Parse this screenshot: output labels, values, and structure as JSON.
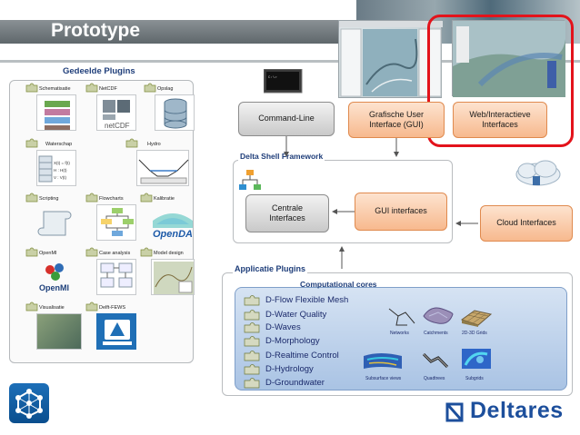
{
  "header": {
    "title": "Prototype"
  },
  "left_panel": {
    "title": "Gedeelde Plugins",
    "plugins": [
      {
        "label": "Schematisatie"
      },
      {
        "label": "NetCDF",
        "image_text": "netCDF"
      },
      {
        "label": "Opslag"
      },
      {
        "label": "Waterschap",
        "image_text": "X(t) = f(t)\nH : H(t)\nV : V(t)"
      },
      {
        "label": "Hydro"
      },
      {
        "label": "Scripting"
      },
      {
        "label": "Flowcharts"
      },
      {
        "label": "Kalibratie",
        "image_text": "OpenDA"
      },
      {
        "label": "OpenMI",
        "image_text": "OpenMI"
      },
      {
        "label": "Case analysis"
      },
      {
        "label": "Model design"
      },
      {
        "label": "Visualisatie"
      },
      {
        "label": "Delft-FEWS"
      }
    ]
  },
  "top_boxes": {
    "command_line": "Command-Line",
    "gui": "Grafische User Interface (GUI)",
    "web": "Web/Interactieve Interfaces"
  },
  "framework": {
    "title": "Delta Shell Framework",
    "central": "Centrale Interfaces",
    "gui_interfaces": "GUI interfaces"
  },
  "cloud": {
    "label": "Cloud Interfaces"
  },
  "app_plugins": {
    "title": "Applicatie Plugins",
    "cores_title": "Computational cores",
    "cores": [
      "D-Flow Flexible Mesh",
      "D-Water Quality",
      "D-Waves",
      "D-Morphology",
      "D-Realtime Control",
      "D-Hydrology",
      "D-Groundwater"
    ],
    "thumbs": [
      "Networks",
      "Catchments",
      "2D-3D Grids",
      "Subsurface views",
      "Quadtrees",
      "Subgrids"
    ]
  },
  "footer": {
    "brand": "Deltares"
  },
  "colors": {
    "red_highlight": "#e3131b",
    "orange_box": "#f7b98e",
    "brand_blue": "#1d4f9c",
    "cores_blue": "#a9c3e4"
  }
}
